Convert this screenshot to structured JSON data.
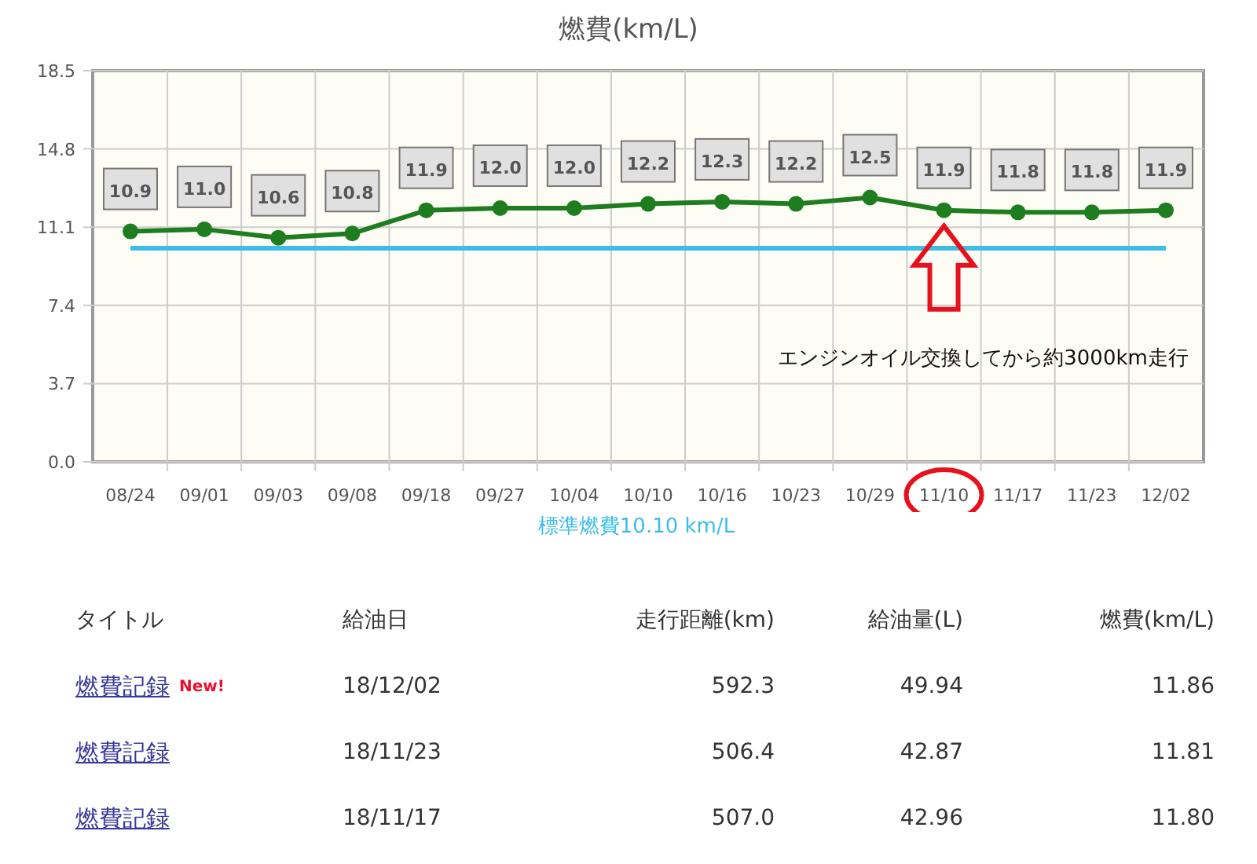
{
  "chart_data": {
    "type": "line",
    "title": "燃費(km/L)",
    "categories": [
      "08/24",
      "09/01",
      "09/03",
      "09/08",
      "09/18",
      "09/27",
      "10/04",
      "10/10",
      "10/16",
      "10/23",
      "10/29",
      "11/10",
      "11/17",
      "11/23",
      "12/02"
    ],
    "series": [
      {
        "color": "#1e7d1e",
        "marker": "circle",
        "values": [
          10.9,
          11.0,
          10.6,
          10.8,
          11.9,
          12.0,
          12.0,
          12.2,
          12.3,
          12.2,
          12.5,
          11.9,
          11.8,
          11.8,
          11.9
        ],
        "value_labels": [
          "10.9",
          "11.0",
          "10.6",
          "10.8",
          "11.9",
          "12.0",
          "12.0",
          "12.2",
          "12.3",
          "12.2",
          "12.5",
          "11.9",
          "11.8",
          "11.8",
          "11.9"
        ]
      },
      {
        "name": "標準燃費",
        "color": "#3cbde8",
        "values": [
          10.1,
          10.1,
          10.1,
          10.1,
          10.1,
          10.1,
          10.1,
          10.1,
          10.1,
          10.1,
          10.1,
          10.1,
          10.1,
          10.1,
          10.1
        ]
      }
    ],
    "ylim": [
      0,
      18.5
    ],
    "grid": true,
    "yticks": [
      {
        "value": 0,
        "label": "0.0"
      },
      {
        "value": 3.7,
        "label": "3.7"
      },
      {
        "value": 7.4,
        "label": "7.4"
      },
      {
        "value": 11.1,
        "label": "11.1"
      },
      {
        "value": 14.8,
        "label": "14.8"
      },
      {
        "value": 18.5,
        "label": "18.5"
      }
    ],
    "annotations": [
      "エンジンオイル交換してから約3000km走行"
    ]
  },
  "legend_value": "10.10 km/L",
  "table": {
    "columns": [
      "タイトル",
      "給油日",
      "走行距離(km)",
      "給油量(L)",
      "燃費(km/L)"
    ],
    "rows": [
      {
        "title": "燃費記録",
        "badge": "New!",
        "date": "18/12/02",
        "distance": "592.3",
        "fuel": "49.94",
        "mileage": "11.86"
      },
      {
        "title": "燃費記録",
        "date": "18/11/23",
        "distance": "506.4",
        "fuel": "42.87",
        "mileage": "11.81"
      },
      {
        "title": "燃費記録",
        "date": "18/11/17",
        "distance": "507.0",
        "fuel": "42.96",
        "mileage": "11.80"
      }
    ]
  }
}
